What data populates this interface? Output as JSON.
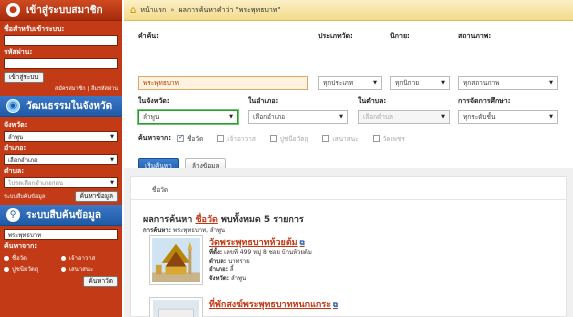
{
  "sidebar": {
    "member": {
      "title": "เข้าสู่ระบบสมาชิก",
      "username_label": "ชื่อสำหรับเข้าระบบ:",
      "password_label": "รหัสผ่าน:",
      "login_button": "เข้าสู่ระบบ",
      "register_link": "สมัครสมาชิก",
      "forgot_link": "ลืมรหัสผ่าน",
      "link_separator": "|"
    },
    "province_culture": {
      "title": "วัฒนธรรมในจังหวัด",
      "province_label": "จังหวัด:",
      "province_value": "ลำพูน",
      "district_label": "อำเภอ:",
      "district_value": "เลือกอำเภอ",
      "subdistrict_label": "ตำบล:",
      "subdistrict_value": "โปรดเลือกอำเภอก่อน",
      "search_condition_text": "ระบบสืบค้นข้อมูล",
      "search_button": "ค้นหาข้อมูล"
    },
    "search_system": {
      "title": "ระบบสืบค้นข้อมูล",
      "search_value": "พระพุทธบาท",
      "search_from_label": "ค้นหาจาก:",
      "radios": [
        "ชื่อวัด",
        "เจ้าอาวาส",
        "ปูชนียวัตถุ",
        "เสนาสนะ"
      ],
      "search_button": "ค้นหาวัด"
    }
  },
  "breadcrumb": {
    "home": "หน้าแรก",
    "separator": "»",
    "current": "ผลการค้นหาคำว่า \"พระพุทธบาท\""
  },
  "form": {
    "keyword_label": "คำค้น:",
    "keyword_value": "พระพุทธบาท",
    "temple_type_label": "ประเภทวัด:",
    "temple_type_value": "ทุกประเภท",
    "sect_label": "นิกาย:",
    "sect_value": "ทุกนิกาย",
    "status_label": "สถานภาพ:",
    "status_value": "ทุกสถานภาพ",
    "province_label": "ในจังหวัด:",
    "province_value": "ลำพูน",
    "district_label": "ในอำเภอ:",
    "district_value": "เลือกอำเภอ",
    "subdistrict_label": "ในตำบล:",
    "subdistrict_value": "เลือกตำบล",
    "education_label": "การจัดการศึกษา:",
    "education_value": "ทุกระดับชั้น",
    "search_from_label": "ค้นหาจาก:",
    "checkboxes": [
      {
        "label": "ชื่อวัด",
        "checked": true
      },
      {
        "label": "เจ้าอาวาส",
        "checked": false
      },
      {
        "label": "ปูชนียวัตถุ",
        "checked": false
      },
      {
        "label": "เสนาสนะ",
        "checked": false
      },
      {
        "label": "วัดเพชร",
        "checked": false
      }
    ],
    "search_button": "เริ่มค้นหา",
    "clear_button": "ล้างข้อมูล"
  },
  "results": {
    "tab_label": "ชื่อวัด",
    "title_prefix": "ผลการค้นหา",
    "title_highlight": "ชื่อวัด",
    "title_suffix": "พบทั้งหมด 5 รายการ",
    "sub_label": "การค้นหา:",
    "sub_value": "พระพุทธบาท, ลำพูน",
    "items": [
      {
        "name": "วัดพระพุทธบาทห้วยต้ม",
        "address_label": "ที่ตั้ง:",
        "address_value": "เลขที่ 499 หมู่ 8 ซอย บ้านห้วยต้ม",
        "subdistrict_label": "ตำบล:",
        "subdistrict_value": "นาทราย",
        "district_label": "อำเภอ:",
        "district_value": "ลี้",
        "province_label": "จังหวัด:",
        "province_value": "ลำพูน"
      },
      {
        "name": "ที่พักสงฆ์พระพุทธบาทหนกแกระ"
      }
    ]
  },
  "colors": {
    "sidebar_red": "#c23a16",
    "section_blue": "#1f5aa6",
    "breadcrumb_bg": "#f3dc8a",
    "link_red": "#c23a16"
  },
  "icons": [
    "user-icon",
    "globe-icon",
    "search-icon",
    "home-icon",
    "external-link-icon",
    "dropdown-arrow-icon"
  ]
}
